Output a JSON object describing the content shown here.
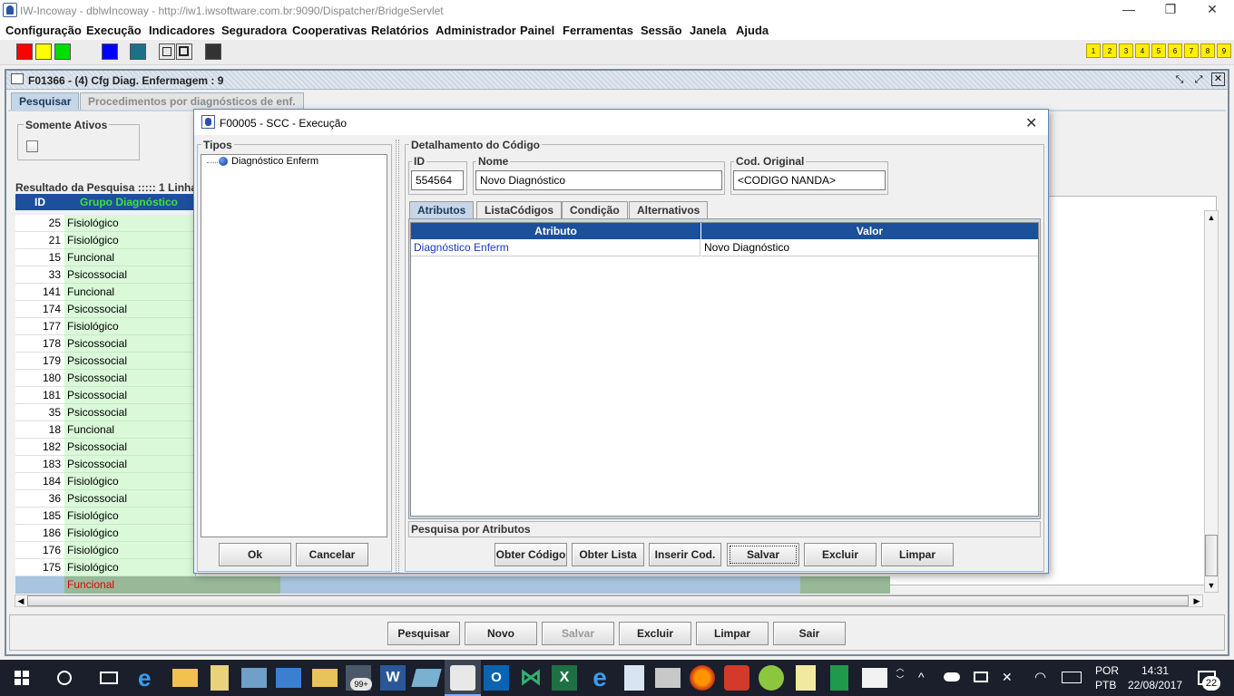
{
  "window": {
    "title": "IW-Incoway - dblwIncoway - http://iw1.iwsoftware.com.br:9090/Dispatcher/BridgeServlet",
    "min": "—",
    "max": "❐",
    "close": "✕"
  },
  "menu": [
    "Configuração",
    "Execução",
    "Indicadores",
    "Seguradora",
    "Cooperativas",
    "Relatórios",
    "Administrador",
    "Painel",
    "Ferramentas",
    "Sessão",
    "Janela",
    "Ajuda"
  ],
  "toolbar": {
    "swatches": [
      "#ff0000",
      "#ffff00",
      "#00dd00",
      "#0000ff",
      "#1e6f8a",
      "#333333"
    ],
    "numbers": [
      "1",
      "2",
      "3",
      "4",
      "5",
      "6",
      "7",
      "8",
      "9"
    ]
  },
  "frame": {
    "title": "F01366 - (4) Cfg Diag. Enfermagem : 9",
    "tabs": [
      "Pesquisar",
      "Procedimentos por diagnósticos de enf."
    ],
    "filter_legend": "Somente Ativos",
    "results_label": "Resultado da Pesquisa ::::: 1 Linhas"
  },
  "table": {
    "headers": [
      "ID",
      "Grupo Diagnóstico"
    ],
    "rows": [
      {
        "id": "25",
        "group": "Fisiológico"
      },
      {
        "id": "21",
        "group": "Fisiológico"
      },
      {
        "id": "15",
        "group": "Funcional"
      },
      {
        "id": "33",
        "group": "Psicossocial"
      },
      {
        "id": "141",
        "group": "Funcional"
      },
      {
        "id": "174",
        "group": "Psicossocial"
      },
      {
        "id": "177",
        "group": "Fisiológico"
      },
      {
        "id": "178",
        "group": "Psicossocial"
      },
      {
        "id": "179",
        "group": "Psicossocial"
      },
      {
        "id": "180",
        "group": "Psicossocial"
      },
      {
        "id": "181",
        "group": "Psicossocial"
      },
      {
        "id": "35",
        "group": "Psicossocial"
      },
      {
        "id": "18",
        "group": "Funcional"
      },
      {
        "id": "182",
        "group": "Psicossocial"
      },
      {
        "id": "183",
        "group": "Psicossocial"
      },
      {
        "id": "184",
        "group": "Fisiológico"
      },
      {
        "id": "36",
        "group": "Psicossocial"
      },
      {
        "id": "185",
        "group": "Fisiológico"
      },
      {
        "id": "186",
        "group": "Fisiológico"
      },
      {
        "id": "176",
        "group": "Fisiológico"
      },
      {
        "id": "175",
        "group": "Fisiológico"
      }
    ],
    "selected_group": "Funcional"
  },
  "bottom_buttons": [
    "Pesquisar",
    "Novo",
    "Salvar",
    "Excluir",
    "Limpar",
    "Sair"
  ],
  "dialog": {
    "title": "F00005 - SCC - Execução",
    "types_legend": "Tipos",
    "tree_item": "Diagnóstico Enferm",
    "ok": "Ok",
    "cancel": "Cancelar",
    "detail_legend": "Detalhamento do Código",
    "id_label": "ID",
    "id_value": "554564",
    "name_label": "Nome",
    "name_value": "Novo Diagnóstico",
    "orig_label": "Cod. Original",
    "orig_value": "<CODIGO NANDA>",
    "tabs": [
      "Atributos",
      "ListaCódigos",
      "Condição",
      "Alternativos"
    ],
    "attr_headers": [
      "Atributo",
      "Valor"
    ],
    "attr_row": {
      "attr": "Diagnóstico Enferm",
      "value": "Novo Diagnóstico"
    },
    "search_label": "Pesquisa por Atributos",
    "buttons": [
      "Obter Código",
      "Obter Lista",
      "Inserir Cod.",
      "Salvar",
      "Excluir",
      "Limpar"
    ]
  },
  "taskbar": {
    "lang1": "POR",
    "lang2": "PTB",
    "time": "14:31",
    "date": "22/08/2017",
    "badge": "99+",
    "notif": "22"
  }
}
